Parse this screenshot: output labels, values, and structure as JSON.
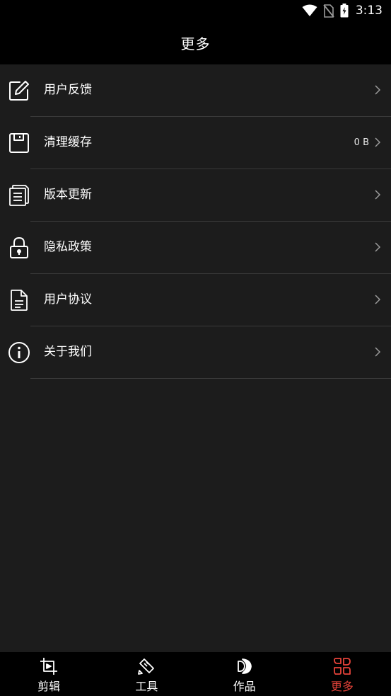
{
  "status_bar": {
    "time": "3:13"
  },
  "header": {
    "title": "更多"
  },
  "menu": {
    "items": [
      {
        "label": "用户反馈",
        "icon": "edit-icon"
      },
      {
        "label": "清理缓存",
        "icon": "save-icon",
        "value": "0 B"
      },
      {
        "label": "版本更新",
        "icon": "documents-icon"
      },
      {
        "label": "隐私政策",
        "icon": "lock-icon"
      },
      {
        "label": "用户协议",
        "icon": "file-text-icon"
      },
      {
        "label": "关于我们",
        "icon": "info-icon"
      }
    ]
  },
  "bottom_nav": {
    "tabs": [
      {
        "label": "剪辑",
        "icon": "crop-play-icon"
      },
      {
        "label": "工具",
        "icon": "tools-icon"
      },
      {
        "label": "作品",
        "icon": "works-icon"
      },
      {
        "label": "更多",
        "icon": "more-grid-icon",
        "active": true
      }
    ]
  },
  "colors": {
    "accent": "#e6433a",
    "background": "#1c1c1c",
    "bar": "#000000"
  }
}
